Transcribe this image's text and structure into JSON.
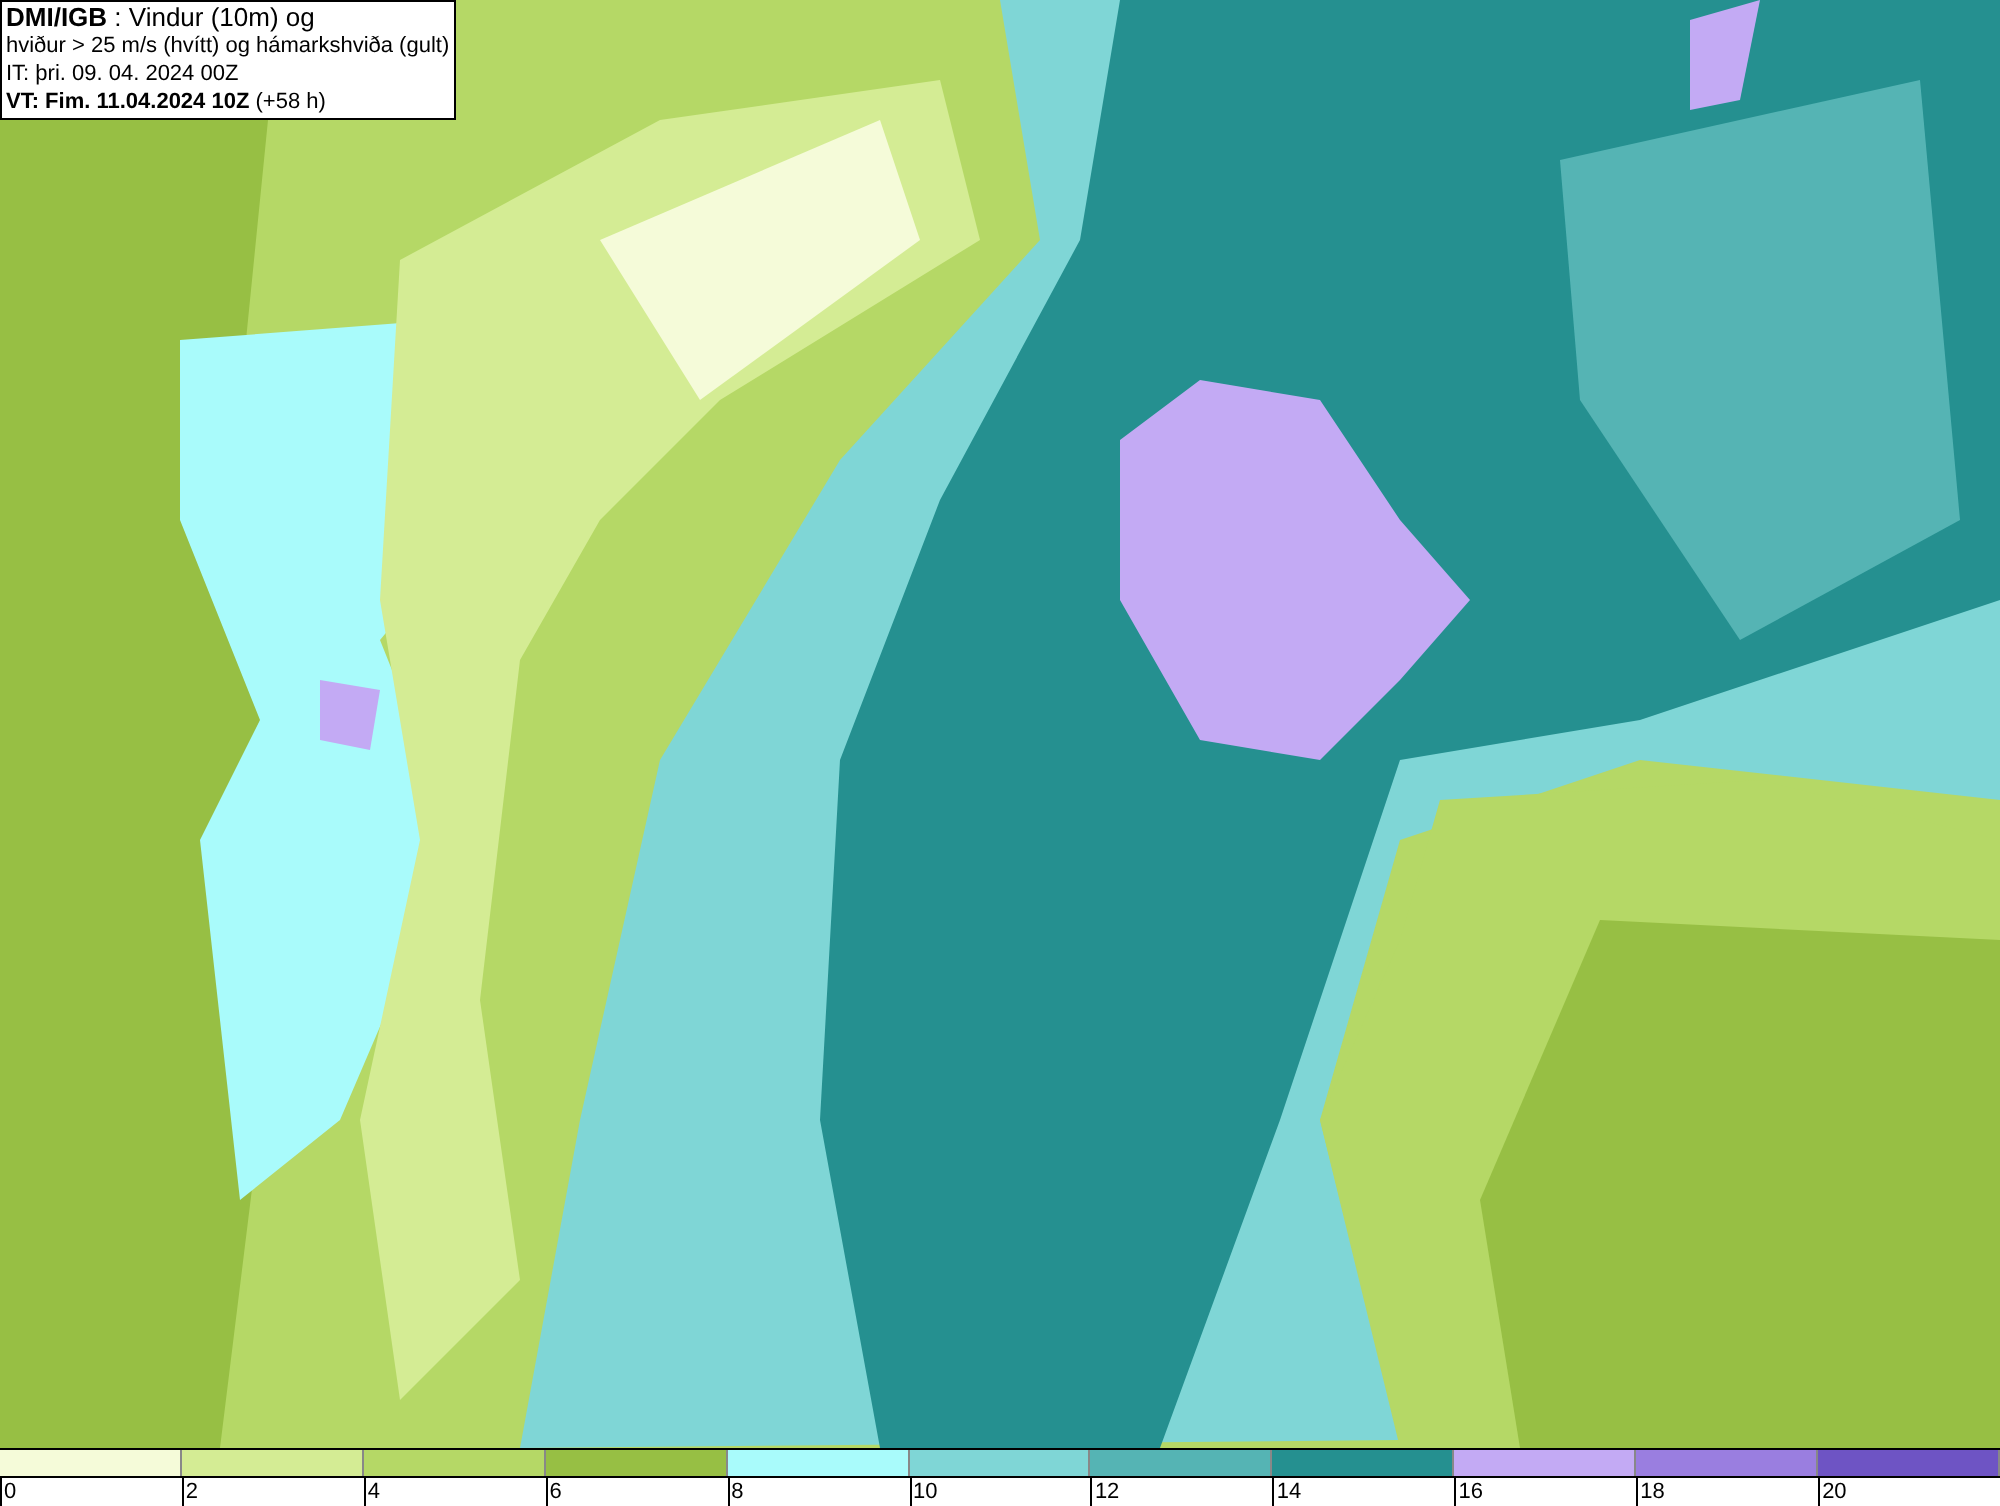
{
  "title_box": {
    "lines": [
      "**DMI/IGB** : Vindur (10m) og",
      "hviður > 25 m/s (hvítt) og hámarkshviða (gult)",
      "IT: þri. 09. 04. 2024 00Z",
      "**VT: Fim. 11.04.2024 10Z** (+58 h)"
    ]
  },
  "legend": {
    "segments": [
      {
        "color": "#f5fbd9"
      },
      {
        "color": "#d4ec94"
      },
      {
        "color": "#b5d866"
      },
      {
        "color": "#97bf44"
      },
      {
        "color": "#a9fbfb"
      },
      {
        "color": "#7fd6d6"
      },
      {
        "color": "#55b4b4"
      },
      {
        "color": "#259090"
      },
      {
        "color": "#c3aaf4"
      },
      {
        "color": "#9a7ee0"
      },
      {
        "color": "#6e54c4"
      }
    ],
    "ticks": [
      "0",
      "2",
      "4",
      "6",
      "8",
      "10",
      "12",
      "14",
      "16",
      "18",
      "20"
    ]
  }
}
